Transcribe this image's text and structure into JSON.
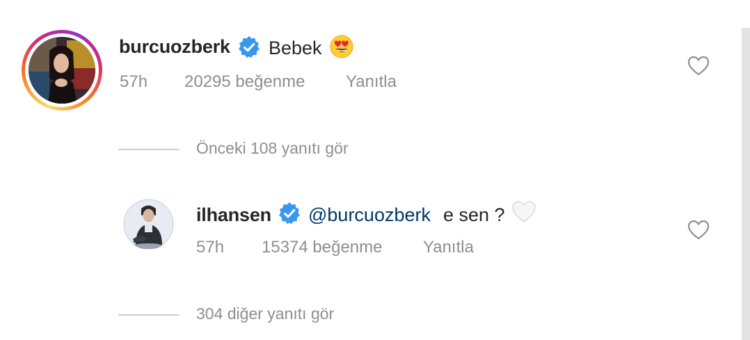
{
  "main_comment": {
    "username": "burcuozberk",
    "verified": true,
    "text": "Bebek",
    "emoji": "heart-eyes-emoji",
    "time": "57h",
    "likes": "20295 beğenme",
    "reply_label": "Yanıtla"
  },
  "view_previous": "Önceki 108 yanıtı gör",
  "reply": {
    "username": "ilhansen",
    "verified": true,
    "mention": "@burcuozberk",
    "text": "e sen ?",
    "emoji": "white-heart-emoji",
    "time": "57h",
    "likes": "15374 beğenme",
    "reply_label": "Yanıtla"
  },
  "view_more": "304 diğer yanıtı gör",
  "colors": {
    "verified_blue": "#3897f0",
    "mention": "#00376b",
    "meta_gray": "#8e8e8e"
  }
}
